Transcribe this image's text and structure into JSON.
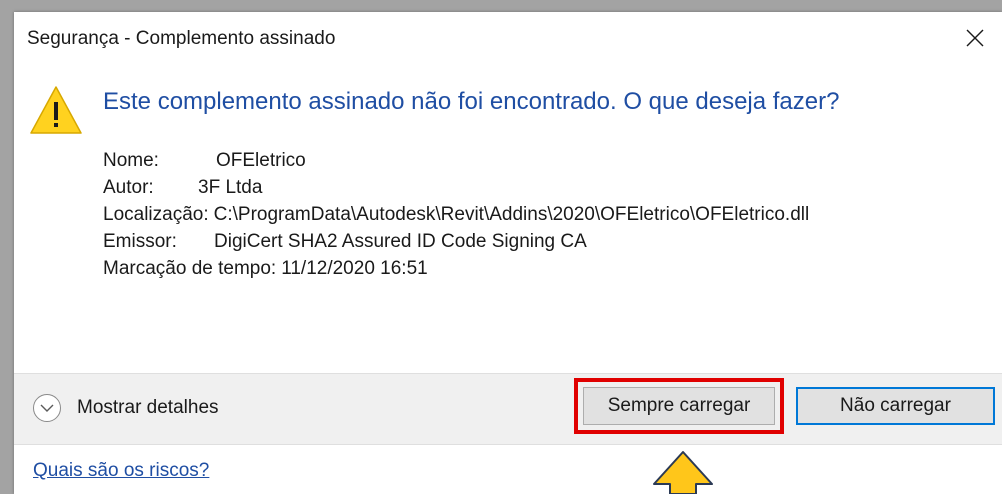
{
  "dialog": {
    "title": "Segurança - Complemento assinado",
    "close_glyph": "✕",
    "headline": "Este complemento assinado não foi encontrado. O que deseja fazer?",
    "info": [
      {
        "label": "Nome:",
        "value": "OFEletrico"
      },
      {
        "label": "Autor:",
        "value": "3F Ltda"
      },
      {
        "label": "Localização:",
        "value": "C:\\ProgramData\\Autodesk\\Revit\\Addins\\2020\\OFEletrico\\OFEletrico.dll"
      },
      {
        "label": "Emissor:",
        "value": "DigiCert SHA2 Assured ID Code Signing CA"
      },
      {
        "label": "Marcação de tempo:",
        "value": "11/12/2020 16:51"
      }
    ],
    "details_label": "Mostrar detalhes",
    "buttons": {
      "always_load": "Sempre carregar",
      "never_load": "Não carregar"
    },
    "risks_link": "Quais são os riscos?"
  },
  "icons": {
    "warning": "warning-triangle-icon",
    "close": "close-icon",
    "chevron": "chevron-down-icon",
    "arrow": "up-arrow-annotation"
  },
  "colors": {
    "headline": "#1f4ea3",
    "warning_fill": "#ffd21f",
    "highlight": "#e00000",
    "arrow_fill": "#ffc61a",
    "default_button_border": "#0078d7"
  }
}
